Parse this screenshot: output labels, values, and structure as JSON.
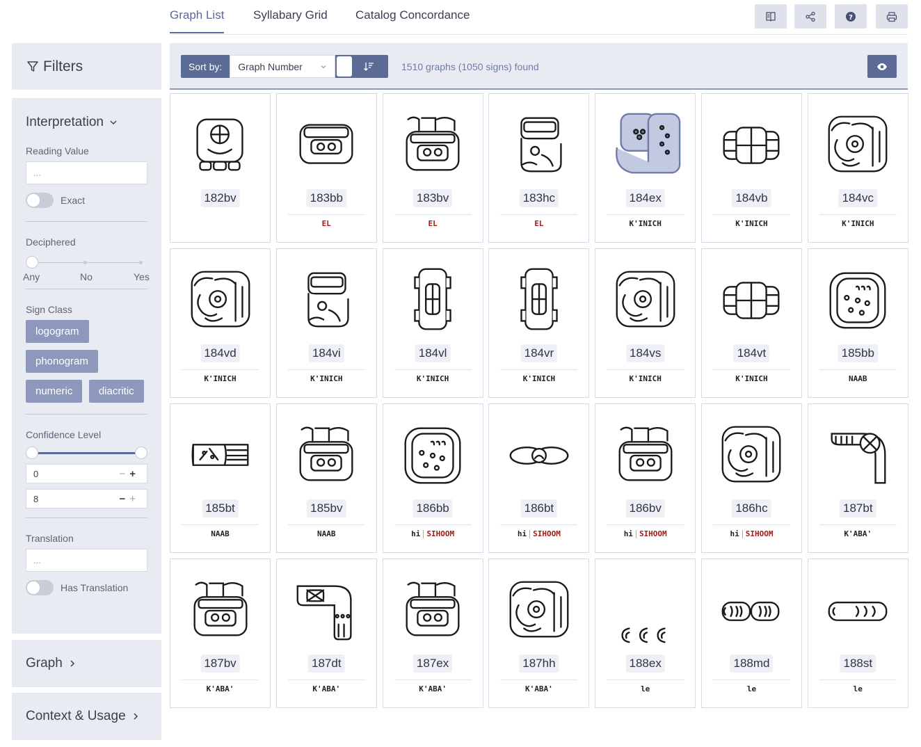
{
  "tabs": [
    {
      "label": "Graph List",
      "active": true
    },
    {
      "label": "Syllabary Grid",
      "active": false
    },
    {
      "label": "Catalog Concordance",
      "active": false
    }
  ],
  "toolbar_icons": [
    "book-icon",
    "share-icon",
    "help-icon",
    "print-icon"
  ],
  "sidebar": {
    "filters_label": "Filters",
    "interpretation": {
      "title": "Interpretation",
      "reading_value_label": "Reading Value",
      "reading_value_placeholder": "...",
      "exact_label": "Exact",
      "deciphered_label": "Deciphered",
      "deciphered_options": [
        "Any",
        "No",
        "Yes"
      ],
      "sign_class_label": "Sign Class",
      "sign_classes": [
        "logogram",
        "phonogram",
        "numeric",
        "diacritic"
      ],
      "confidence_label": "Confidence Level",
      "confidence_min": "0",
      "confidence_max": "8",
      "translation_label": "Translation",
      "translation_placeholder": "...",
      "has_translation_label": "Has Translation"
    },
    "graph_label": "Graph",
    "context_label": "Context & Usage"
  },
  "sort": {
    "label": "Sort by:",
    "value": "Graph Number"
  },
  "result_count": "1510 graphs (1050 signs) found",
  "colors": {
    "accent": "#5b6b95",
    "panel": "#e9ebf2",
    "chip": "#8e98bc",
    "red": "#a11c1c"
  },
  "cards": [
    {
      "id": "182bv",
      "reading": [],
      "shape": "a"
    },
    {
      "id": "183bb",
      "reading": [
        {
          "t": "EL",
          "red": true
        }
      ],
      "shape": "b"
    },
    {
      "id": "183bv",
      "reading": [
        {
          "t": "EL",
          "red": true
        }
      ],
      "shape": "c"
    },
    {
      "id": "183hc",
      "reading": [
        {
          "t": "EL",
          "red": true
        }
      ],
      "shape": "d"
    },
    {
      "id": "184ex",
      "reading": [
        {
          "t": "K'INICH",
          "red": false
        }
      ],
      "shape": "e"
    },
    {
      "id": "184vb",
      "reading": [
        {
          "t": "K'INICH",
          "red": false
        }
      ],
      "shape": "f"
    },
    {
      "id": "184vc",
      "reading": [
        {
          "t": "K'INICH",
          "red": false
        }
      ],
      "shape": "g"
    },
    {
      "id": "184vd",
      "reading": [
        {
          "t": "K'INICH",
          "red": false
        }
      ],
      "shape": "g"
    },
    {
      "id": "184vi",
      "reading": [
        {
          "t": "K'INICH",
          "red": false
        }
      ],
      "shape": "d"
    },
    {
      "id": "184vl",
      "reading": [
        {
          "t": "K'INICH",
          "red": false
        }
      ],
      "shape": "h"
    },
    {
      "id": "184vr",
      "reading": [
        {
          "t": "K'INICH",
          "red": false
        }
      ],
      "shape": "h"
    },
    {
      "id": "184vs",
      "reading": [
        {
          "t": "K'INICH",
          "red": false
        }
      ],
      "shape": "g"
    },
    {
      "id": "184vt",
      "reading": [
        {
          "t": "K'INICH",
          "red": false
        }
      ],
      "shape": "f"
    },
    {
      "id": "185bb",
      "reading": [
        {
          "t": "NAAB",
          "red": false
        }
      ],
      "shape": "i"
    },
    {
      "id": "185bt",
      "reading": [
        {
          "t": "NAAB",
          "red": false
        }
      ],
      "shape": "j"
    },
    {
      "id": "185bv",
      "reading": [
        {
          "t": "NAAB",
          "red": false
        }
      ],
      "shape": "c"
    },
    {
      "id": "186bb",
      "reading": [
        {
          "t": "hi",
          "red": false
        },
        {
          "t": "SIHOOM",
          "red": true
        }
      ],
      "shape": "i"
    },
    {
      "id": "186bt",
      "reading": [
        {
          "t": "hi",
          "red": false
        },
        {
          "t": "SIHOOM",
          "red": true
        }
      ],
      "shape": "k"
    },
    {
      "id": "186bv",
      "reading": [
        {
          "t": "hi",
          "red": false
        },
        {
          "t": "SIHOOM",
          "red": true
        }
      ],
      "shape": "c"
    },
    {
      "id": "186hc",
      "reading": [
        {
          "t": "hi",
          "red": false
        },
        {
          "t": "SIHOOM",
          "red": true
        }
      ],
      "shape": "g"
    },
    {
      "id": "187bt",
      "reading": [
        {
          "t": "K'ABA'",
          "red": false
        }
      ],
      "shape": "l"
    },
    {
      "id": "187bv",
      "reading": [
        {
          "t": "K'ABA'",
          "red": false
        }
      ],
      "shape": "c"
    },
    {
      "id": "187dt",
      "reading": [
        {
          "t": "K'ABA'",
          "red": false
        }
      ],
      "shape": "m"
    },
    {
      "id": "187ex",
      "reading": [
        {
          "t": "K'ABA'",
          "red": false
        }
      ],
      "shape": "c"
    },
    {
      "id": "187hh",
      "reading": [
        {
          "t": "K'ABA'",
          "red": false
        }
      ],
      "shape": "g"
    },
    {
      "id": "188ex",
      "reading": [
        {
          "t": "le",
          "red": false
        }
      ],
      "shape": "n"
    },
    {
      "id": "188md",
      "reading": [
        {
          "t": "le",
          "red": false
        }
      ],
      "shape": "o"
    },
    {
      "id": "188st",
      "reading": [
        {
          "t": "le",
          "red": false
        }
      ],
      "shape": "p"
    }
  ]
}
